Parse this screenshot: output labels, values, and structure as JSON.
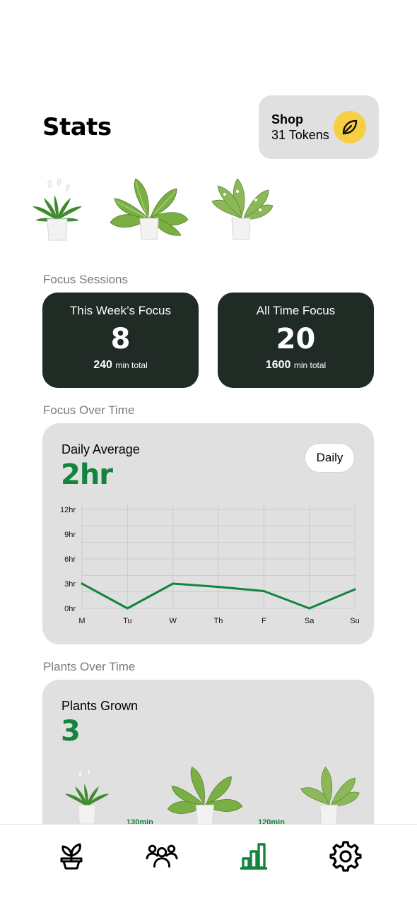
{
  "header": {
    "title": "Stats"
  },
  "shop": {
    "label": "Shop",
    "tokens": "31 Tokens",
    "icon": "leaf-icon",
    "icon_color": "#f7cf45"
  },
  "focus_sessions": {
    "section_label": "Focus Sessions",
    "week": {
      "heading": "This Week’s Focus",
      "count": "8",
      "minutes": "240",
      "unit": "min total"
    },
    "all_time": {
      "heading": "All Time Focus",
      "count": "20",
      "minutes": "1600",
      "unit": "min total"
    }
  },
  "focus_over_time": {
    "section_label": "Focus Over Time",
    "heading": "Daily Average",
    "value": "2hr",
    "period_button": "Daily"
  },
  "plants_over_time": {
    "section_label": "Plants Over Time",
    "heading": "Plants Grown",
    "value": "3",
    "marker_labels": [
      "130min",
      "120min"
    ]
  },
  "nav": {
    "items": [
      {
        "icon": "plant-icon",
        "active": false
      },
      {
        "icon": "community-icon",
        "active": false
      },
      {
        "icon": "stats-icon",
        "active": true
      },
      {
        "icon": "settings-icon",
        "active": false
      }
    ],
    "active_color": "#12843f"
  },
  "colors": {
    "accent": "#12843f",
    "dark_card": "#202b25",
    "card": "#e0e0e0"
  },
  "chart_data": {
    "type": "line",
    "categories": [
      "M",
      "Tu",
      "W",
      "Th",
      "F",
      "Sa",
      "Su"
    ],
    "yticks": [
      "12hr",
      "9hr",
      "6hr",
      "3hr",
      "0hr"
    ],
    "ylim": [
      0,
      12
    ],
    "series": [
      {
        "values": [
          3.0,
          0.0,
          3.0,
          2.6,
          2.1,
          0.0,
          2.3
        ]
      }
    ],
    "line_color": "#12843f",
    "grid": true
  }
}
